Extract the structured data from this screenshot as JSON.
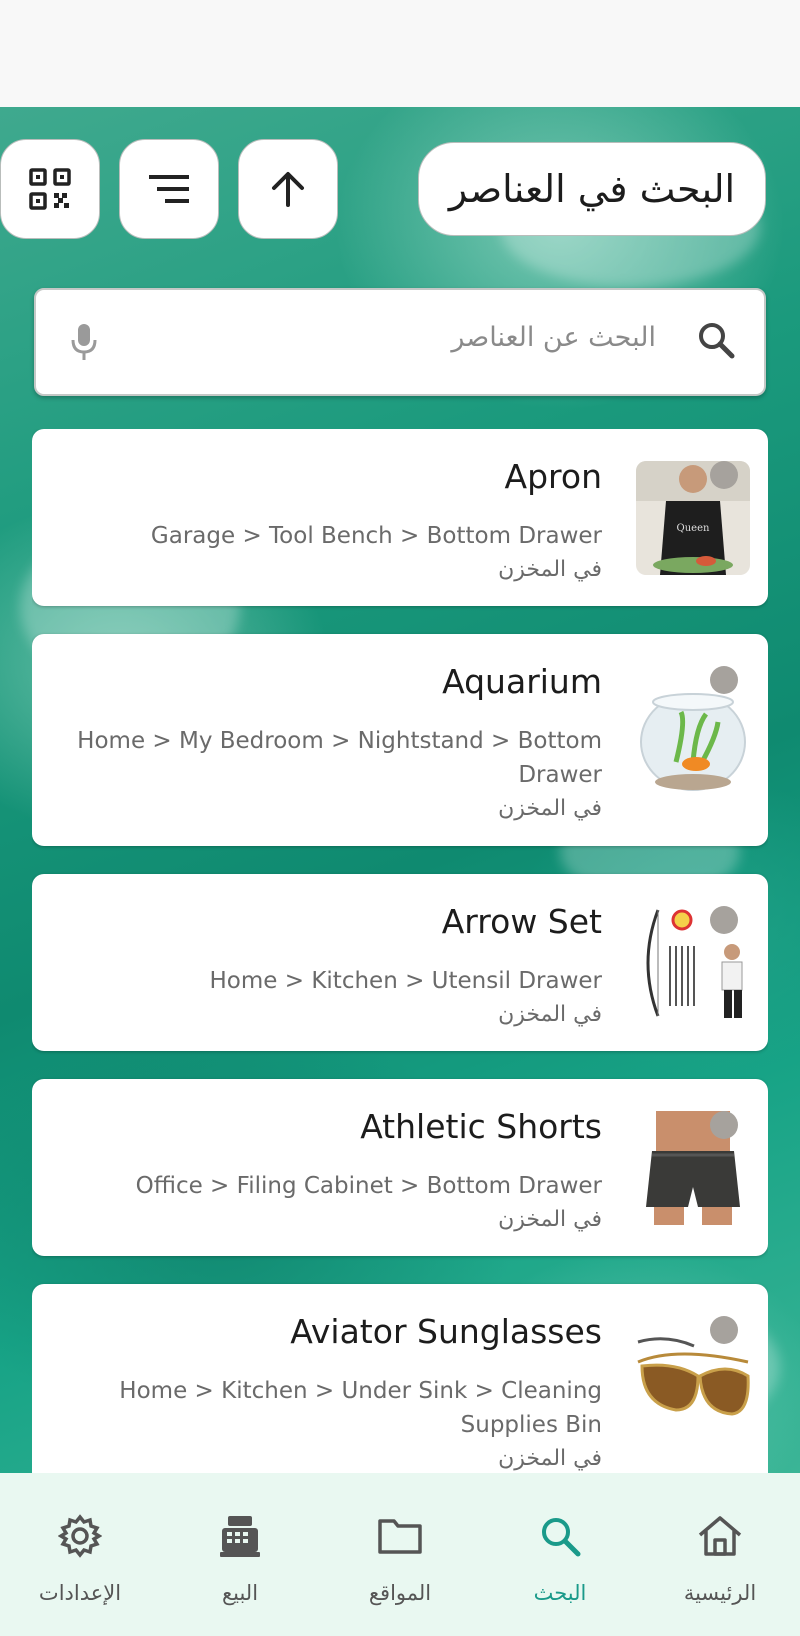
{
  "header": {
    "title": "البحث في العناصر",
    "buttons": [
      {
        "name": "qr-code-scan-button",
        "icon": "qr-code-icon"
      },
      {
        "name": "sort-button",
        "icon": "sort-lines-icon"
      },
      {
        "name": "scroll-up-button",
        "icon": "arrow-up-icon"
      }
    ]
  },
  "search": {
    "placeholder": "البحث عن العناصر",
    "icon": "search-icon",
    "voice_icon": "mic-icon"
  },
  "items": [
    {
      "name": "Apron",
      "path": "Garage > Tool Bench > Bottom Drawer",
      "status": "في المخزن",
      "thumb": "apron-photo"
    },
    {
      "name": "Aquarium",
      "path": "Home > My Bedroom > Nightstand > Bottom Drawer",
      "status": "في المخزن",
      "thumb": "aquarium-photo"
    },
    {
      "name": "Arrow Set",
      "path": "Home > Kitchen > Utensil Drawer",
      "status": "في المخزن",
      "thumb": "archery-photo"
    },
    {
      "name": "Athletic Shorts",
      "path": "Office > Filing Cabinet > Bottom Drawer",
      "status": "في المخزن",
      "thumb": "shorts-photo"
    },
    {
      "name": "Aviator Sunglasses",
      "path": "Home > Kitchen > Under Sink > Cleaning Supplies Bin",
      "status": "في المخزن",
      "thumb": "sunglasses-photo"
    }
  ],
  "bottom_nav": [
    {
      "label": "الإعدادات",
      "icon": "gear-icon",
      "active": false
    },
    {
      "label": "البيع",
      "icon": "cash-register-icon",
      "active": false
    },
    {
      "label": "المواقع",
      "icon": "folder-icon",
      "active": false
    },
    {
      "label": "البحث",
      "icon": "search-icon",
      "active": true
    },
    {
      "label": "الرئيسية",
      "icon": "home-icon",
      "active": false
    }
  ],
  "colors": {
    "accent": "#1a9a8a",
    "nav_background": "#e9f8f1",
    "status_dot": "#a6a29d"
  }
}
